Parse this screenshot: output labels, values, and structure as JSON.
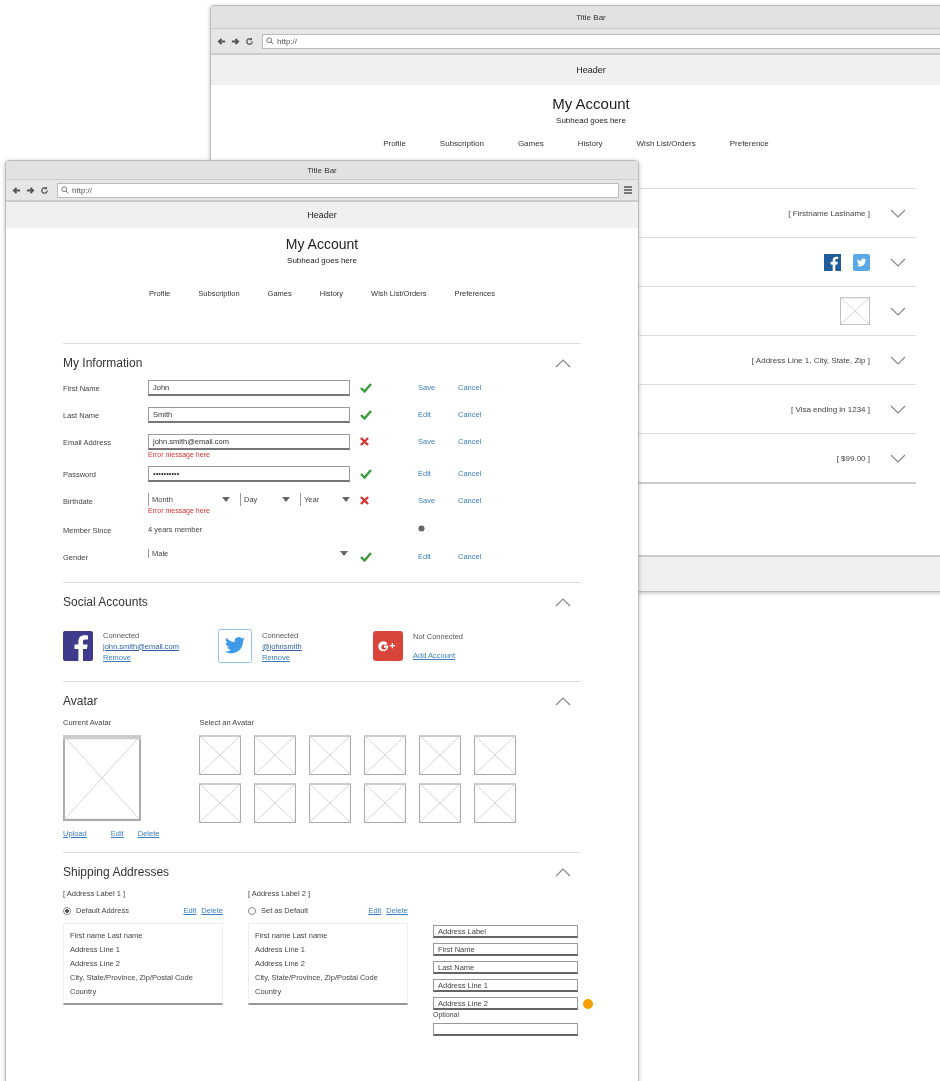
{
  "back_window": {
    "title": "Title Bar",
    "url": "http://",
    "header": "Header",
    "heading": "My Account",
    "subheading": "Subhead goes here",
    "nav": [
      "Profile",
      "Subscription",
      "Games",
      "History",
      "Wish List/Orders",
      "Preference"
    ],
    "sections": [
      {
        "kind": "text",
        "summary": "[ Firstname  Lastname ]",
        "expanded": false
      },
      {
        "kind": "social",
        "expanded": false
      },
      {
        "kind": "image",
        "expanded": false
      },
      {
        "kind": "text",
        "summary": "[ Address Line 1, City, State, Zip ]",
        "expanded": false
      },
      {
        "kind": "text",
        "summary": "[ Visa ending in 1234 ]",
        "expanded": false
      },
      {
        "kind": "text",
        "summary": "[ $99.00 ]",
        "expanded": false
      }
    ]
  },
  "front_window": {
    "title": "Title Bar",
    "url": "http://",
    "header": "Header",
    "heading": "My Account",
    "subheading": "Subhead goes here",
    "nav": [
      "Profile",
      "Subscription",
      "Games",
      "History",
      "Wish List/Orders",
      "Preferences"
    ],
    "information": {
      "title": "My Information",
      "expanded": true,
      "rows": [
        {
          "kind": "input",
          "label": "First Name",
          "value": "John",
          "valid": true,
          "actions": [
            "Save",
            "Cancel"
          ]
        },
        {
          "kind": "input",
          "label": "Last Name",
          "value": "Smith",
          "valid": true,
          "actions": [
            "Edit",
            "Cancel"
          ]
        },
        {
          "kind": "input",
          "label": "Email Address",
          "value": "john.smith@email.com",
          "valid": false,
          "error": "Error message here",
          "actions": [
            "Save",
            "Cancel"
          ]
        },
        {
          "kind": "input",
          "label": "Password",
          "value": "••••••••••",
          "valid": true,
          "actions": [
            "Edit",
            "Cancel"
          ]
        },
        {
          "kind": "date",
          "label": "Birthdate",
          "selects": [
            "Month",
            "Day",
            "Year"
          ],
          "valid": false,
          "error": "Error message here",
          "actions": [
            "Save",
            "Cancel"
          ]
        },
        {
          "kind": "static",
          "label": "Member Since",
          "value": "4 years member"
        },
        {
          "kind": "select",
          "label": "Gender",
          "value": "Male",
          "valid": true,
          "actions": [
            "Edit",
            "Cancel"
          ]
        }
      ]
    },
    "social": {
      "title": "Social Accounts",
      "expanded": true,
      "accounts": [
        {
          "kind": "facebook",
          "status": "Connected",
          "account": "john.smith@email.com",
          "action": "Remove"
        },
        {
          "kind": "twitter",
          "status": "Connected",
          "account": "@johnsmith",
          "action": "Remove"
        },
        {
          "kind": "google",
          "status": "Not Connected",
          "action": "Add Account"
        }
      ]
    },
    "avatar": {
      "title": "Avatar",
      "expanded": true,
      "current_label": "Current Avatar",
      "select_label": "Select an Avatar",
      "links": [
        "Upload",
        "Edit",
        "Delete"
      ]
    },
    "shipping": {
      "title": "Shipping Addresses",
      "expanded": true,
      "addresses": [
        {
          "label": "[ Address Label 1 ]",
          "default": true,
          "radio_label": "Default Address",
          "actions": [
            "Edit",
            "Delete"
          ],
          "lines": [
            "First name  Last name",
            "Address Line 1",
            "Address Line 2",
            "City, State/Province, Zip/Postal Code",
            "Country"
          ]
        },
        {
          "label": "[ Address Label 2 ]",
          "default": false,
          "radio_label": "Set as Default",
          "actions": [
            "Edit",
            "Delete"
          ],
          "lines": [
            "First name  Last name",
            "Address Line 1",
            "Address Line 2",
            "City, State/Province, Zip/Postal Code",
            "Country"
          ]
        }
      ],
      "form": [
        {
          "placeholder": "Address Label",
          "flagged": false
        },
        {
          "placeholder": "First Name",
          "flagged": false
        },
        {
          "placeholder": "Last Name",
          "flagged": false
        },
        {
          "placeholder": "Address Line 1",
          "flagged": false
        },
        {
          "placeholder": "Address Line 2",
          "flagged": true,
          "note": "Optional"
        }
      ]
    }
  }
}
